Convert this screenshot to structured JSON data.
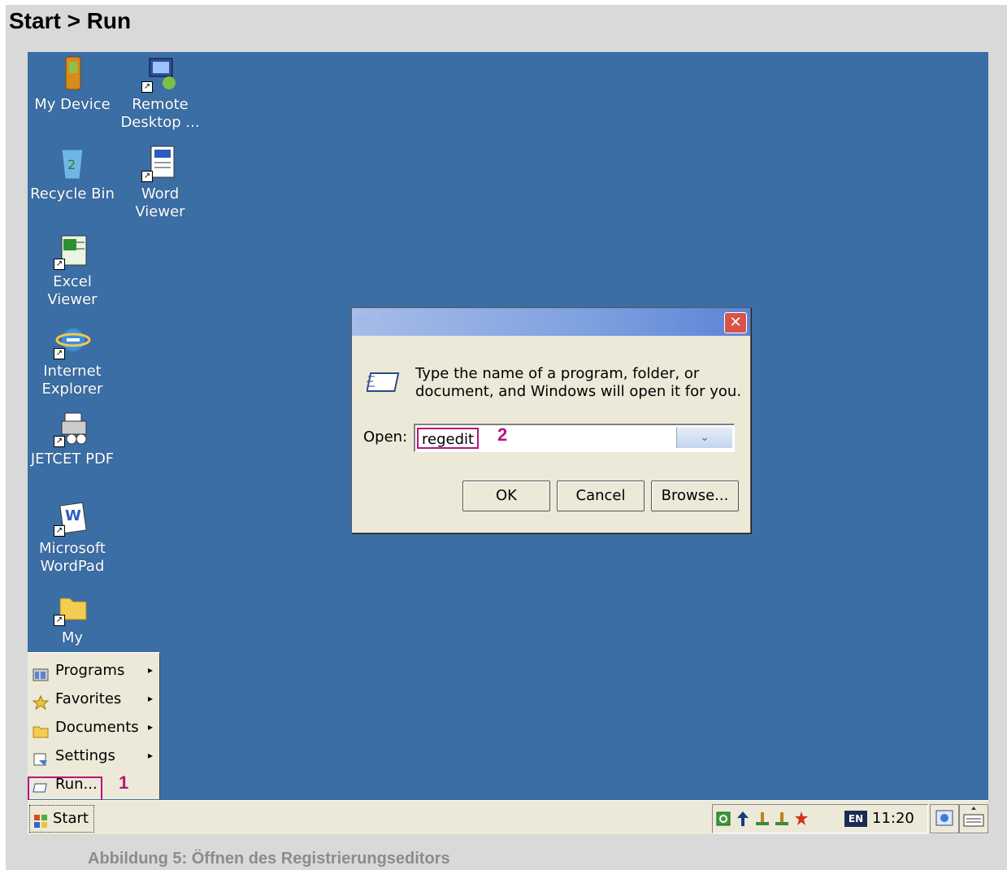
{
  "heading": "Start > Run",
  "caption": "Abbildung 5: Öffnen des Registrierungseditors",
  "desktop": {
    "icons": [
      {
        "label": "My Device"
      },
      {
        "label": "Remote\nDesktop ..."
      },
      {
        "label": "Recycle Bin"
      },
      {
        "label": "Word\nViewer"
      },
      {
        "label": "Excel Viewer"
      },
      {
        "label": "Internet\nExplorer"
      },
      {
        "label": "JETCET PDF"
      },
      {
        "label": "Microsoft\nWordPad"
      },
      {
        "label": "My"
      }
    ]
  },
  "run_dialog": {
    "title": "Run",
    "close": "✕",
    "description": "Type the name of a program, folder, or\ndocument, and Windows will open it for you.",
    "open_label": "Open:",
    "open_value": "regedit",
    "dropdown": "⌄",
    "ok": "OK",
    "cancel": "Cancel",
    "browse": "Browse..."
  },
  "start_menu": {
    "items": [
      {
        "label": "Programs",
        "arrow": "▸"
      },
      {
        "label": "Favorites",
        "arrow": "▸"
      },
      {
        "label": "Documents",
        "arrow": "▸"
      },
      {
        "label": "Settings",
        "arrow": "▸"
      },
      {
        "label": "Run..."
      }
    ]
  },
  "annotations": {
    "step1": "1",
    "step2": "2",
    "color": "#b4167f"
  },
  "taskbar": {
    "start_label": "Start",
    "lang": "EN",
    "clock": "11:20 AM"
  },
  "colors": {
    "desktop": "#3a6ea5",
    "taskbar": "#ece9d8"
  }
}
